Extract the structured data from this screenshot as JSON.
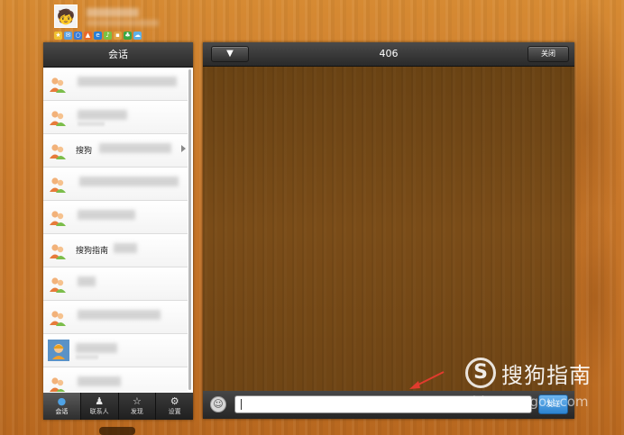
{
  "profile": {
    "avatar_icon": "user-avatar-icon",
    "tool_icons": [
      "star-icon",
      "mail-icon",
      "search-icon",
      "shop-icon",
      "ie-icon",
      "music-icon",
      "bag-icon",
      "clover-icon",
      "cloud-icon"
    ]
  },
  "sidebar": {
    "header": "会话",
    "items": [
      {
        "label": "",
        "icon": "group-avatar-icon"
      },
      {
        "label": "",
        "icon": "group-avatar-icon"
      },
      {
        "label": "搜狗",
        "icon": "group-avatar-icon"
      },
      {
        "label": "",
        "icon": "group-avatar-icon"
      },
      {
        "label": "",
        "icon": "group-avatar-icon"
      },
      {
        "label": "搜狗指南",
        "icon": "group-avatar-icon"
      },
      {
        "label": "",
        "icon": "group-avatar-icon"
      },
      {
        "label": "",
        "icon": "group-avatar-icon"
      },
      {
        "label": "",
        "icon": "user-photo-icon"
      },
      {
        "label": "",
        "icon": "group-avatar-icon"
      }
    ],
    "tabs": [
      {
        "label": "会话",
        "icon": "chat-bubble-icon",
        "active": true
      },
      {
        "label": "联系人",
        "icon": "contact-icon",
        "active": false
      },
      {
        "label": "发现",
        "icon": "star-icon",
        "active": false
      },
      {
        "label": "设置",
        "icon": "gear-icon",
        "active": false
      }
    ]
  },
  "chat": {
    "title": "406",
    "menu_glyph": "▼",
    "close_label": "关闭",
    "input_value": "",
    "send_label": "发送"
  },
  "watermark": {
    "logo": "S",
    "text": "搜狗指南",
    "url": "zhinan.sogou.com"
  },
  "colors": {
    "accent": "#3a8fdc",
    "header_dark": "#2b2b2b",
    "wood": "#c9782a",
    "chat_bg": "#6f4515",
    "arrow": "#e23b2e"
  }
}
